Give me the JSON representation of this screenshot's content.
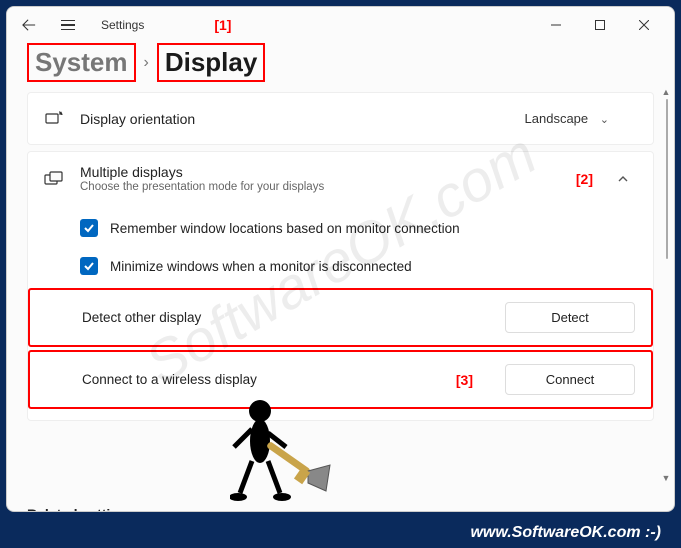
{
  "app": {
    "title": "Settings"
  },
  "breadcrumb": {
    "parent": "System",
    "current": "Display"
  },
  "annotations": {
    "a1": "[1]",
    "a2": "[2]",
    "a3": "[3]"
  },
  "orientation": {
    "label": "Display orientation",
    "value": "Landscape"
  },
  "multiple": {
    "title": "Multiple displays",
    "subtitle": "Choose the presentation mode for your displays",
    "remember": "Remember window locations based on monitor connection",
    "minimize": "Minimize windows when a monitor is disconnected",
    "detect_label": "Detect other display",
    "detect_btn": "Detect",
    "connect_label": "Connect to a wireless display",
    "connect_btn": "Connect"
  },
  "related": "Related settings",
  "watermark": "SoftwareOK.com",
  "footer": "www.SoftwareOK.com :-)"
}
